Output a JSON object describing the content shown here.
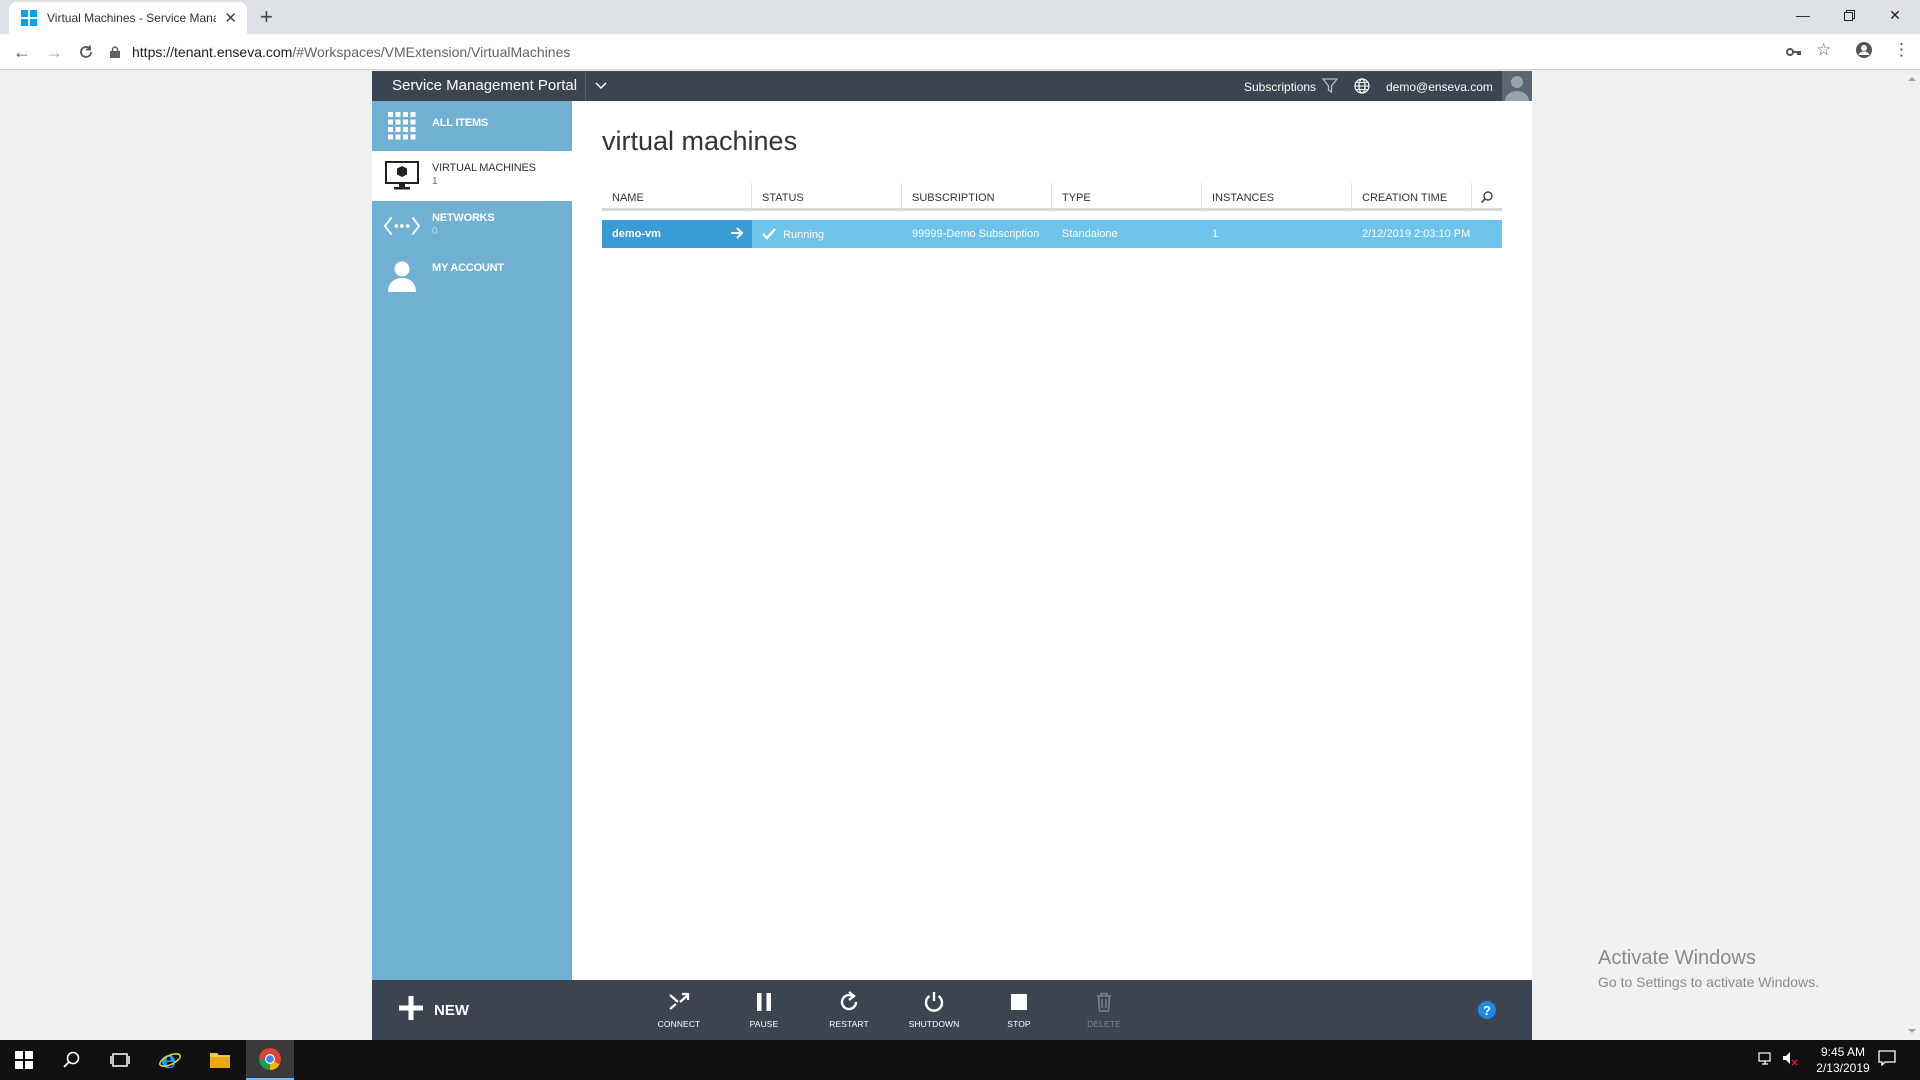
{
  "browser": {
    "tab_title": "Virtual Machines - Service Manag",
    "url_host": "https://tenant.enseva.com",
    "url_path": "/#Workspaces/VMExtension/VirtualMachines"
  },
  "portal": {
    "title": "Service Management Portal",
    "subscriptions_label": "Subscriptions",
    "user_email": "demo@enseva.com"
  },
  "sidebar": {
    "items": [
      {
        "label": "ALL ITEMS",
        "count": ""
      },
      {
        "label": "VIRTUAL MACHINES",
        "count": "1"
      },
      {
        "label": "NETWORKS",
        "count": "0"
      },
      {
        "label": "MY ACCOUNT",
        "count": ""
      }
    ]
  },
  "main": {
    "title": "virtual machines",
    "columns": [
      "NAME",
      "STATUS",
      "SUBSCRIPTION",
      "TYPE",
      "INSTANCES",
      "CREATION TIME"
    ],
    "rows": [
      {
        "name": "demo-vm",
        "status": "Running",
        "subscription": "99999-Demo Subscription",
        "type": "Standalone",
        "instances": "1",
        "creation_time": "2/12/2019 2:03:10 PM"
      }
    ]
  },
  "commandbar": {
    "new_label": "NEW",
    "actions": [
      {
        "label": "CONNECT",
        "icon": "connect-icon",
        "enabled": true
      },
      {
        "label": "PAUSE",
        "icon": "pause-icon",
        "enabled": true
      },
      {
        "label": "RESTART",
        "icon": "restart-icon",
        "enabled": true
      },
      {
        "label": "SHUTDOWN",
        "icon": "power-icon",
        "enabled": true
      },
      {
        "label": "STOP",
        "icon": "stop-icon",
        "enabled": true
      },
      {
        "label": "DELETE",
        "icon": "trash-icon",
        "enabled": false
      }
    ]
  },
  "watermark": {
    "title": "Activate Windows",
    "subtitle": "Go to Settings to activate Windows."
  },
  "taskbar": {
    "time": "9:45 AM",
    "date": "2/13/2019"
  },
  "colors": {
    "sidebar": "#70b1d3",
    "header": "#3b444f",
    "row_selected": "#6ec3ea",
    "name_cell": "#3b9bd5"
  }
}
